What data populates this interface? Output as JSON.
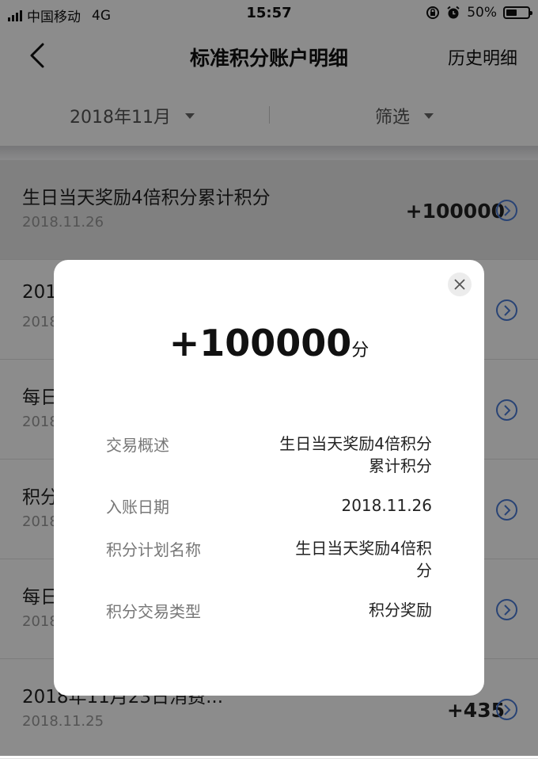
{
  "status_bar": {
    "carrier": "中国移动",
    "network": "4G",
    "time": "15:57",
    "battery": "50%",
    "battery_level": 0.5
  },
  "nav": {
    "title": "标准积分账户明细",
    "right_link": "历史明细"
  },
  "filters": {
    "month": "2018年11月",
    "filter": "筛选"
  },
  "list": {
    "rows": [
      {
        "title": "生日当天奖励4倍积分累计积分",
        "date": "2018.11.26",
        "amount": "+100000"
      },
      {
        "title": "201",
        "date": "2018",
        "amount": ""
      },
      {
        "title": "每日",
        "date": "2018",
        "amount": ""
      },
      {
        "title": "积分",
        "date": "2018",
        "amount": ""
      },
      {
        "title": "每日",
        "date": "2018",
        "amount": ""
      },
      {
        "title": "2018年11月23日消费...",
        "date": "2018.11.25",
        "amount": "+435"
      }
    ]
  },
  "modal": {
    "amount": "+100000",
    "unit": "分",
    "details": [
      {
        "label": "交易概述",
        "value": "生日当天奖励4倍积分累计积分"
      },
      {
        "label": "入账日期",
        "value": "2018.11.26"
      },
      {
        "label": "积分计划名称",
        "value": "生日当天奖励4倍积分"
      },
      {
        "label": "积分交易类型",
        "value": "积分奖励"
      }
    ]
  },
  "colors": {
    "accent": "#4a7ad6",
    "overlay": "rgba(0,0,0,0.45)"
  }
}
